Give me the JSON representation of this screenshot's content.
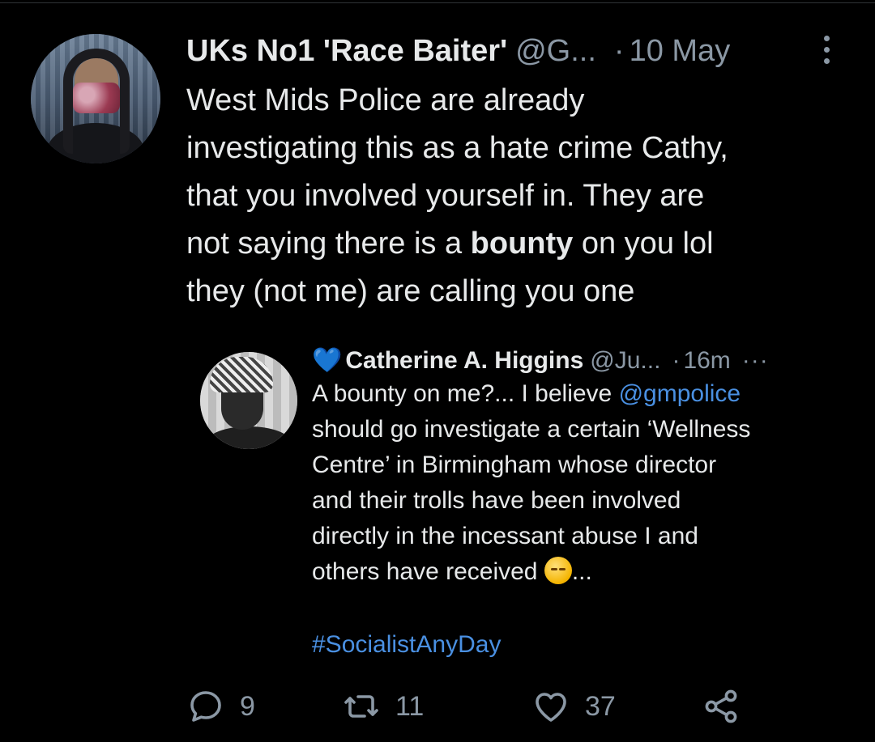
{
  "tweet": {
    "author_name": "UKs No1 'Race Baiter'",
    "handle": "@G...",
    "separator": "·",
    "time": "10 May",
    "text": {
      "line1": "West Mids Police are already",
      "line2": "investigating this as a hate crime Cathy,",
      "line3": "that you involved yourself in. They are",
      "line4_pre": "not saying there is a ",
      "line4_bold": "bounty",
      "line4_post": " on you lol",
      "line5": "they (not me) are calling you one"
    }
  },
  "embedded": {
    "heart": "💙",
    "author_name": "Catherine A. Higgins",
    "handle": "@Ju...",
    "separator": "·",
    "time": "16m",
    "more": "···",
    "text": {
      "line1": "A bounty on me?... I believe ",
      "mention": "@gmpolice",
      "line2": "should go investigate a certain ‘Wellness",
      "line3": "Centre’ in Birmingham whose director",
      "line4": "and their trolls have been involved",
      "line5": "directly in the incessant abuse I and",
      "line6_pre": "others have received ",
      "line6_post": "..."
    },
    "hashtag": "#SocialistAnyDay"
  },
  "actions": {
    "replies": "9",
    "retweets": "11",
    "likes": "37"
  },
  "icons": {
    "reply": "reply-icon",
    "retweet": "retweet-icon",
    "like": "heart-icon",
    "share": "share-icon",
    "more": "more-vertical-icon",
    "emoji": "pensive-face-emoji"
  }
}
